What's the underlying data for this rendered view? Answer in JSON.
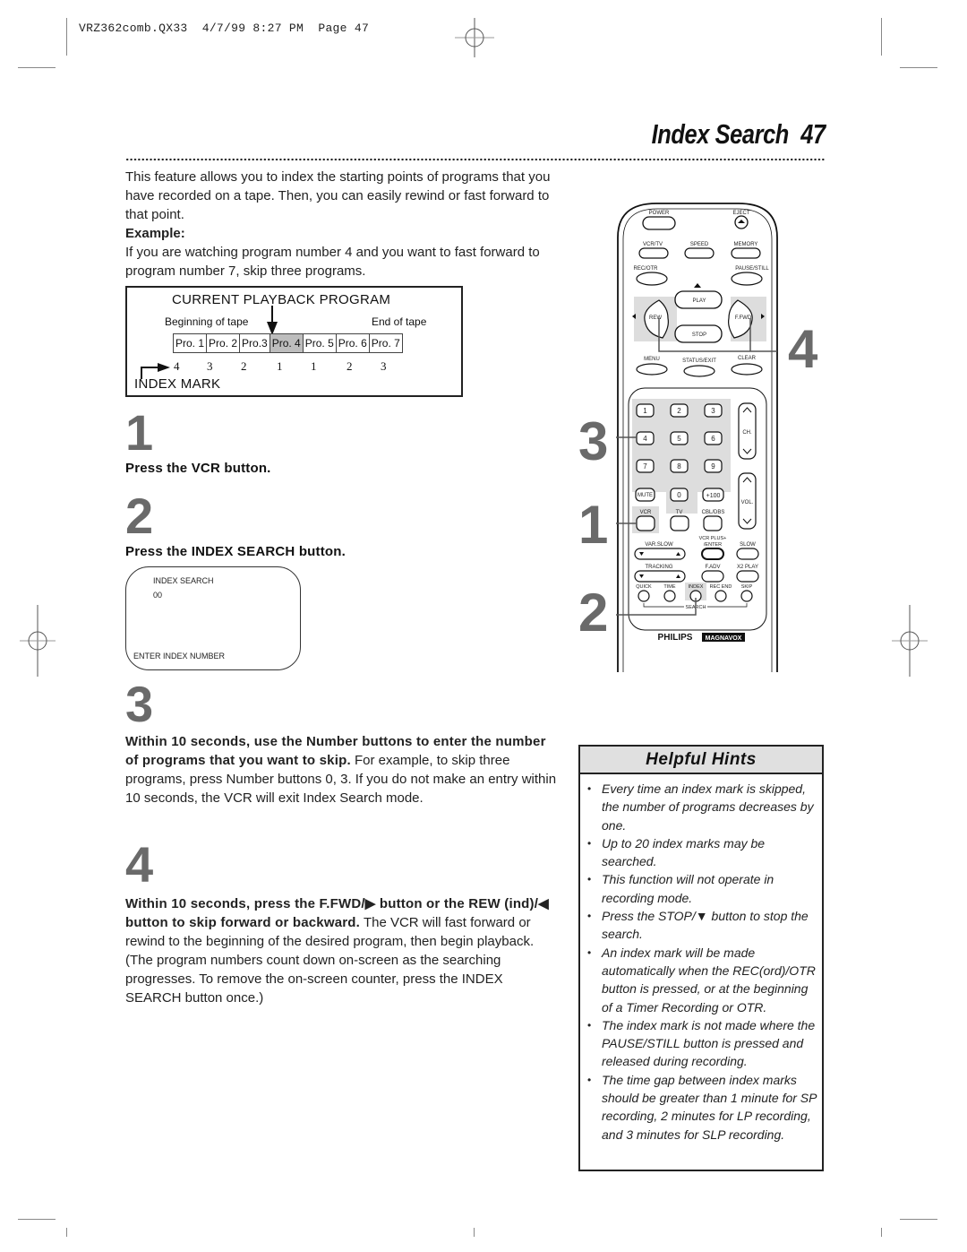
{
  "slug": "VRZ362comb.QX33  4/7/99 8:27 PM  Page 47",
  "header": {
    "title": "Index Search",
    "page_number": "47"
  },
  "intro": {
    "paragraph": "This feature allows you to index the starting points of programs that you have recorded on a tape. Then, you can easily rewind or fast forward to that point.",
    "example_label": "Example:",
    "example_text": "If you are watching program number 4 and you want to fast forward to program number 7, skip three programs."
  },
  "diagram": {
    "title": "CURRENT PLAYBACK PROGRAM",
    "beginning_label": "Beginning of tape",
    "end_label": "End of tape",
    "programs": [
      "Pro. 1",
      "Pro. 2",
      "Pro.3",
      "Pro. 4",
      "Pro. 5",
      "Pro. 6",
      "Pro. 7"
    ],
    "current_program_index": 3,
    "index_marks": [
      "4",
      "3",
      "2",
      "1",
      "1",
      "2",
      "3"
    ],
    "index_mark_label": "INDEX MARK"
  },
  "steps": [
    {
      "number": "1",
      "heading": "Press the VCR button."
    },
    {
      "number": "2",
      "heading": "Press the INDEX SEARCH button."
    },
    {
      "number": "3",
      "heading": "Within 10 seconds, use the Number buttons to enter the number of programs that you want to skip.",
      "text": "For example, to skip three programs, press Number buttons 0, 3. If you do not make an entry within 10 seconds, the VCR will exit Index Search mode."
    },
    {
      "number": "4",
      "heading": "Within 10 seconds, press the F.FWD/▶ button or the REW (ind)/◀ button to skip forward or backward.",
      "text": "The VCR will fast forward or rewind to the beginning of the desired program, then begin playback. (The program numbers count down on-screen as the searching progresses. To remove the on-screen counter, press the INDEX SEARCH button once.)"
    }
  ],
  "osd": {
    "title": "INDEX SEARCH",
    "value": "00",
    "prompt": "ENTER INDEX NUMBER"
  },
  "remote": {
    "buttons": {
      "power": "POWER",
      "eject": "EJECT",
      "vcr_tv": "VCR/TV",
      "speed": "SPEED",
      "memory": "MEMORY",
      "rec_otr": "REC/OTR",
      "pause_still": "PAUSE/STILL",
      "play": "PLAY",
      "rew": "REW",
      "ffwd": "F.FWD",
      "stop": "STOP",
      "menu": "MENU",
      "status_exit": "STATUS/EXIT",
      "clear": "CLEAR",
      "digits": [
        "1",
        "2",
        "3",
        "4",
        "5",
        "6",
        "7",
        "8",
        "9"
      ],
      "mute": "MUTE",
      "zero": "0",
      "plus100": "+100",
      "ch": "CH.",
      "vol": "VOL.",
      "vcr": "VCR",
      "tv": "TV",
      "cbl_dbs": "CBL/DBS",
      "var_slow": "VAR.SLOW",
      "vcr_plus_enter": "VCR PLUS+ /ENTER",
      "slow": "SLOW",
      "tracking": "TRACKING",
      "f_adv": "F.ADV",
      "x2_play": "X2 PLAY",
      "quick": "QUICK",
      "time": "TIME",
      "index": "INDEX",
      "rec_end": "REC END",
      "skip": "SKIP",
      "search": "SEARCH"
    },
    "brand_1": "PHILIPS",
    "brand_2": "MAGNAVOX",
    "callouts": [
      "3",
      "1",
      "2",
      "4"
    ]
  },
  "hints": {
    "title": "Helpful Hints",
    "items": [
      "Every time an index mark is skipped, the number of programs decreases by one.",
      "Up to 20 index marks may be searched.",
      "This function will not operate in recording mode.",
      "Press the STOP/▼ button to stop the search.",
      "An index mark will be made automatically when the REC(ord)/OTR button is pressed, or at the beginning of a Timer Recording or OTR.",
      "The index mark is not made where the PAUSE/STILL button is pressed and released during recording.",
      "The time gap between index marks should be greater than 1 minute for SP recording, 2 minutes for LP recording, and 3 minutes for SLP recording."
    ]
  }
}
